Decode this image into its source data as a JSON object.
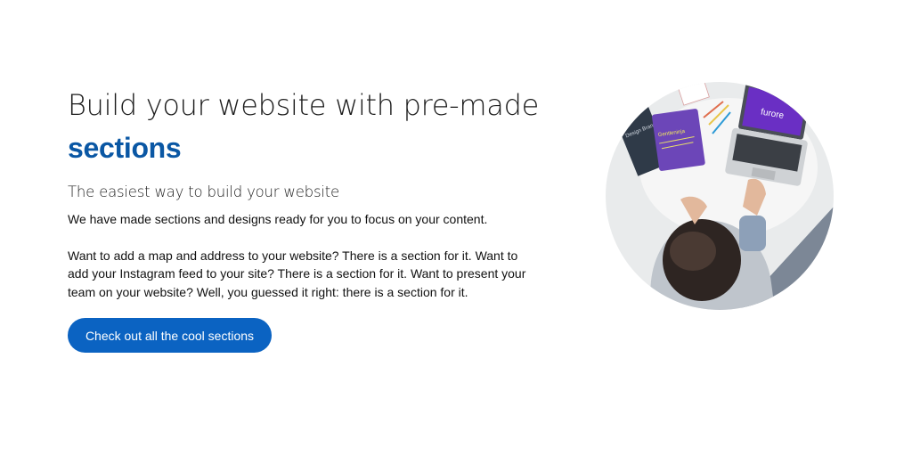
{
  "heading": {
    "line1": "Build your website with pre-made",
    "accent": "sections"
  },
  "subheading": "The easiest way to build your website",
  "paragraphs": [
    "We have made sections and designs ready for you to focus on your content.",
    "Want to add a map and address to your website? There is a section for it. Want to add your Instagram feed to your site? There is a section for it. Want to present your team on your website? Well, you guessed it right: there is a section for it."
  ],
  "cta": {
    "label": "Check out all the cool sections"
  },
  "photo": {
    "laptop_screen_text": "furore",
    "notebook_text": "Gentleninja",
    "book_text": "Design Brand",
    "colors": {
      "accent": "#0a57a4",
      "button": "#0b63c2",
      "laptop_screen": "#6a2fc4",
      "notebook": "#6c46b8"
    }
  }
}
